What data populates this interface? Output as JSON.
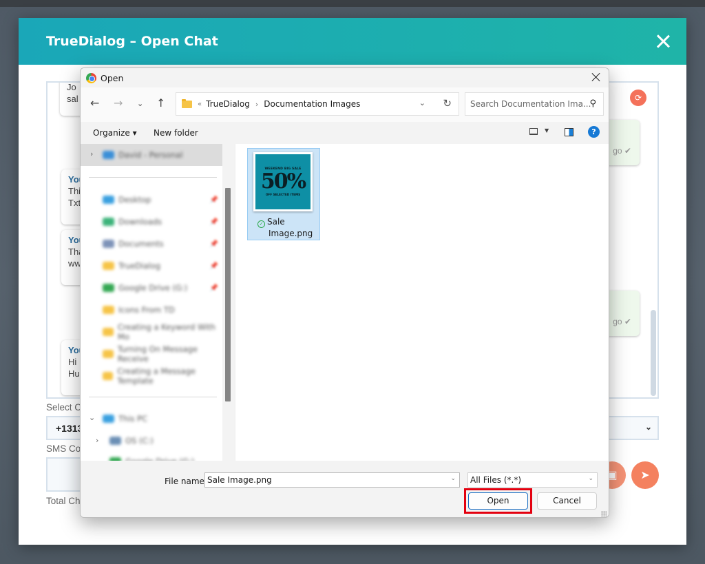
{
  "modal": {
    "title": "TrueDialog – Open Chat",
    "close_icon": "close-icon"
  },
  "chat": {
    "messages": [
      {
        "side": "left",
        "sender": "",
        "lines": [
          "Jo",
          "sal"
        ]
      },
      {
        "side": "left",
        "sender": "You",
        "lines": [
          "Thi",
          "Txt"
        ]
      },
      {
        "side": "left",
        "sender": "You",
        "lines": [
          "Tha",
          "ww"
        ]
      },
      {
        "side": "left",
        "sender": "You",
        "lines": [
          "Hi",
          "Hu"
        ]
      },
      {
        "side": "right",
        "time": "go ✔"
      },
      {
        "side": "right",
        "time": "go ✔"
      }
    ],
    "refresh_icon": "refresh-icon"
  },
  "form": {
    "select_label": "Select C",
    "phone_value": "+1313",
    "sms_label": "SMS Co",
    "total_label": "Total Ch",
    "attach_icon": "image-attach-icon",
    "send_icon": "send-icon"
  },
  "dialog": {
    "title": "Open",
    "breadcrumb": {
      "prefix": "«",
      "items": [
        "TrueDialog",
        "Documentation Images"
      ]
    },
    "search_placeholder": "Search Documentation Ima...",
    "commands": {
      "organize": "Organize ▾",
      "new_folder": "New folder"
    },
    "sidebar": {
      "top_item": "David - Personal",
      "quick_access": [
        {
          "label": "Desktop",
          "color": "#3aa0e0",
          "pinned": true
        },
        {
          "label": "Downloads",
          "color": "#3cb37a",
          "pinned": true
        },
        {
          "label": "Documents",
          "color": "#7d93b8",
          "pinned": true
        },
        {
          "label": "TrueDialog",
          "color": "#f6c447",
          "pinned": true
        },
        {
          "label": "Google Drive (G:)",
          "color": "#34a853",
          "pinned": true
        },
        {
          "label": "Icons From TD",
          "color": "#f6c447",
          "pinned": false
        },
        {
          "label": "Creating a Keyword With Mo",
          "color": "#f6c447",
          "pinned": false
        },
        {
          "label": "Turning On Message Receive",
          "color": "#f6c447",
          "pinned": false
        },
        {
          "label": "Creating a Message Template",
          "color": "#f6c447",
          "pinned": false
        }
      ],
      "this_pc": "This PC",
      "drive": "OS (C:)",
      "more": "Google Drive (G:)"
    },
    "files": [
      {
        "name_line1": "Sale",
        "name_line2": "Image.png",
        "status": "synced",
        "thumbnail": {
          "top": "WEEKEND BIG SALE",
          "big": "50%",
          "bottom": "OFF SELECTED ITEMS"
        },
        "selected": true
      }
    ],
    "footer": {
      "file_name_label": "File name:",
      "file_name_value": "Sale Image.png",
      "file_type": "All Files (*.*)",
      "open_label": "Open",
      "cancel_label": "Cancel"
    }
  },
  "colors": {
    "header_start": "#1aa7b8",
    "header_end": "#1fb4a8",
    "accent_orange": "#f4815f",
    "highlight_red": "#e3000f"
  }
}
